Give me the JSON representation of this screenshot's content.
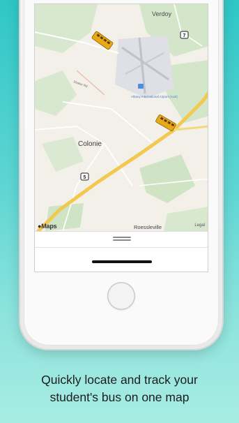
{
  "map": {
    "labels": {
      "verdoy": "Verdoy",
      "airport": "Albany International Airport (ALB)",
      "colonie": "Colonie",
      "roessleville": "Roessleville",
      "shaker_rd": "Shaker Rd"
    },
    "route_shields": [
      "7",
      "5"
    ],
    "attribution": "Maps",
    "legal": "Legal",
    "bus_icon": "school-bus-icon"
  },
  "caption": {
    "line1": "Quickly locate and track your",
    "line2": "student's bus on one map"
  },
  "colors": {
    "background_top": "#2fc6c6",
    "background_bottom": "#a7ece3",
    "highway": "#f1c94f",
    "bus": "#e9a816"
  }
}
